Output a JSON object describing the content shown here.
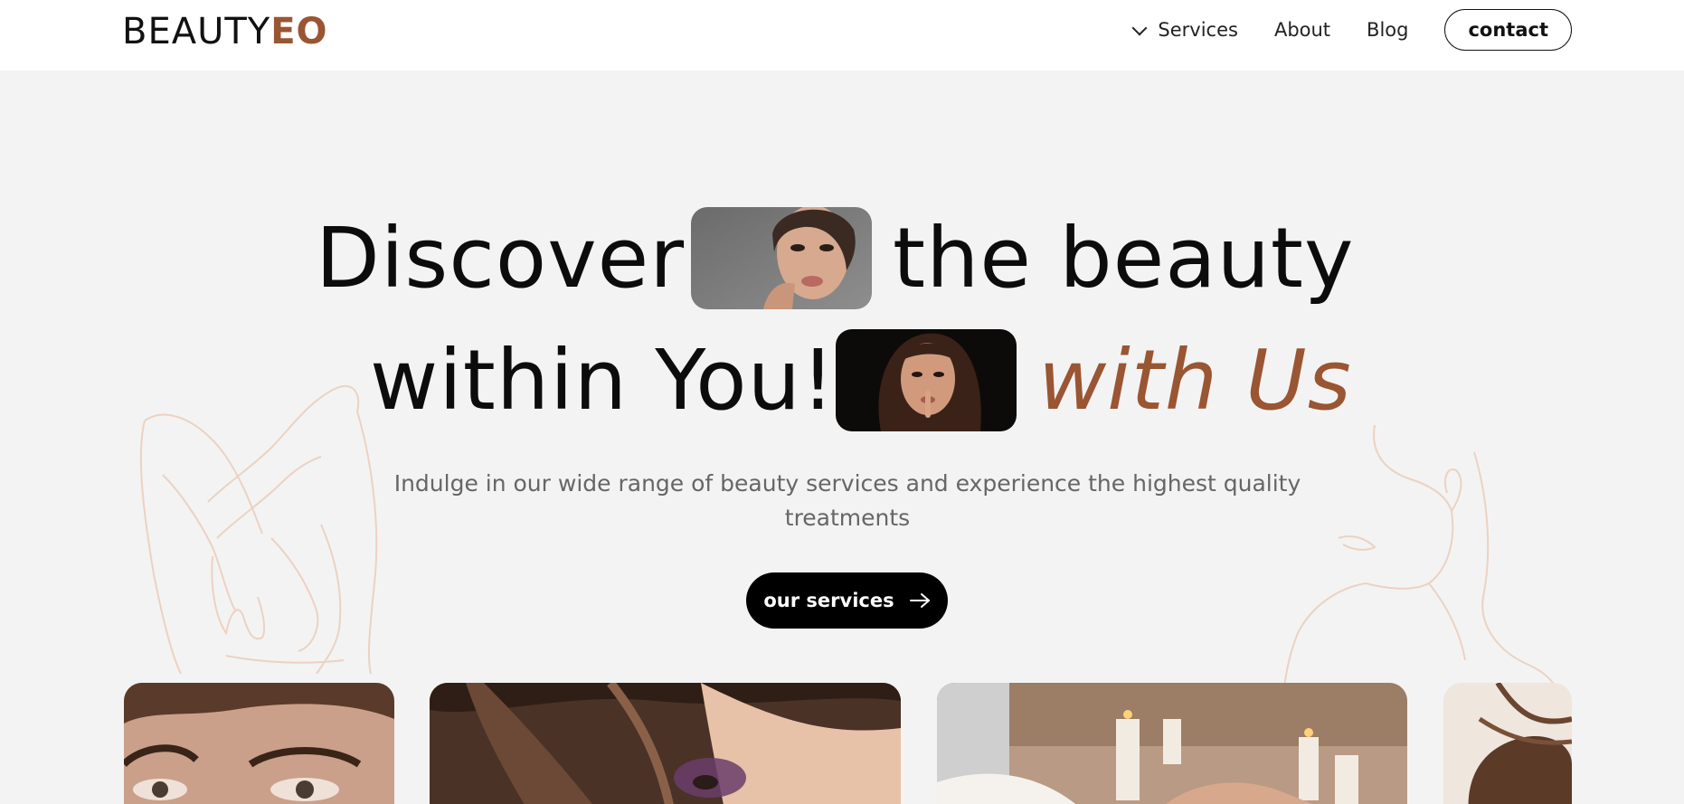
{
  "header": {
    "logo_main": "BEAUTY",
    "logo_accent": "EO",
    "nav": [
      {
        "label": "Services",
        "has_dropdown": true
      },
      {
        "label": "About"
      },
      {
        "label": "Blog"
      }
    ],
    "contact_label": "contact"
  },
  "hero": {
    "line1_a": "Discover",
    "line1_b": "the beauty",
    "line2_a": "within You!",
    "line2_b": "with Us",
    "subtitle": "Indulge in our wide range of beauty services and experience the highest quality treatments",
    "cta_label": "our services"
  },
  "colors": {
    "accent": "#9a5533",
    "background": "#f3f3f3",
    "header_bg": "#ffffff",
    "cta_bg": "#000000",
    "line_art": "#ecd2c2"
  },
  "icons": {
    "dropdown": "chevron-down-icon",
    "cta": "arrow-right-icon"
  }
}
